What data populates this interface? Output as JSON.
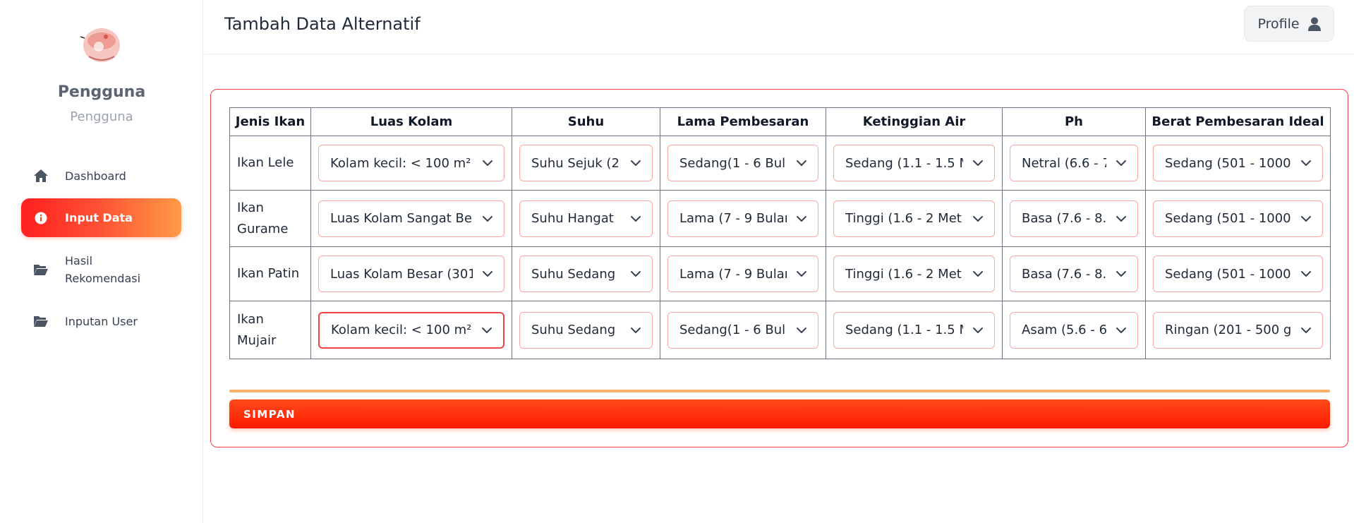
{
  "sidebar": {
    "user_name": "Pengguna",
    "user_role": "Pengguna",
    "items": [
      {
        "label": "Dashboard",
        "icon": "home-icon"
      },
      {
        "label": "Input Data",
        "icon": "info-icon"
      },
      {
        "label": "Hasil Rekomendasi",
        "icon": "folder-open-icon"
      },
      {
        "label": "Inputan User",
        "icon": "folder-open-icon"
      }
    ]
  },
  "header": {
    "title": "Tambah Data Alternatif",
    "profile_label": "Profile"
  },
  "table": {
    "columns": [
      "Jenis Ikan",
      "Luas Kolam",
      "Suhu",
      "Lama Pembesaran",
      "Ketinggian Air",
      "Ph",
      "Berat Pembesaran Ideal"
    ],
    "rows": [
      {
        "name": "Ikan Lele",
        "values": [
          "Kolam kecil: < 100 m²",
          "Suhu Sejuk (2",
          "Sedang(1 - 6 Bul",
          "Sedang (1.1 - 1.5 M",
          "Netral (6.6 - 7",
          "Sedang (501 - 1000"
        ]
      },
      {
        "name": "Ikan Gurame",
        "values": [
          "Luas Kolam Sangat Be",
          "Suhu Hangat",
          "Lama (7 - 9 Bulan",
          "Tinggi (1.6 - 2 Met",
          "Basa (7.6 - 8.",
          "Sedang (501 - 1000"
        ]
      },
      {
        "name": "Ikan Patin",
        "values": [
          "Luas Kolam Besar (301",
          "Suhu Sedang",
          "Lama (7 - 9 Bulan",
          "Tinggi (1.6 - 2 Met",
          "Basa (7.6 - 8.",
          "Sedang (501 - 1000"
        ]
      },
      {
        "name": "Ikan Mujair",
        "values": [
          "Kolam kecil: < 100 m²",
          "Suhu Sedang",
          "Sedang(1 - 6 Bul",
          "Sedang (1.1 - 1.5 M",
          "Asam (5.6 - 6",
          "Ringan (201 - 500 g"
        ]
      }
    ]
  },
  "actions": {
    "save_label": "SIMPAN"
  },
  "colors": {
    "accent": "#ff1a00",
    "accent_gradient_end": "#ff9a45",
    "card_border": "#ef4444",
    "divider": "#f6b26b"
  }
}
